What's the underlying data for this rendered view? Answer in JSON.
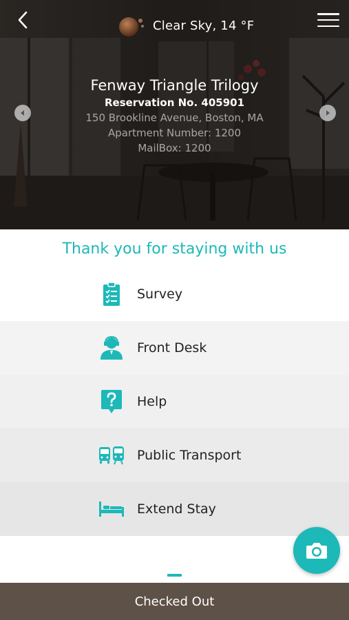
{
  "header": {
    "weather_text": "Clear Sky, 14 °F",
    "icons": {
      "back": "back-chevron-icon",
      "weather": "moon-clear-sky-icon",
      "menu": "hamburger-menu-icon"
    }
  },
  "property": {
    "name": "Fenway Triangle Trilogy",
    "reservation": "Reservation No. 405901",
    "address": "150 Brookline Avenue, Boston, MA",
    "apartment": "Apartment Number: 1200",
    "mailbox": "MailBox: 1200"
  },
  "thanks_message": "Thank you for staying with us",
  "menu_items": [
    {
      "label": "Survey",
      "icon": "clipboard-checklist-icon"
    },
    {
      "label": "Front Desk",
      "icon": "receptionist-headset-icon"
    },
    {
      "label": "Help",
      "icon": "question-mark-icon"
    },
    {
      "label": "Public Transport",
      "icon": "bus-train-icon"
    },
    {
      "label": "Extend Stay",
      "icon": "bed-icon"
    }
  ],
  "bottom_bar": {
    "label": "Checked Out"
  },
  "colors": {
    "accent": "#1db8b8",
    "bottom_bar": "#5e5147",
    "text_dark": "#222222",
    "text_muted": "#a9a6a3"
  }
}
